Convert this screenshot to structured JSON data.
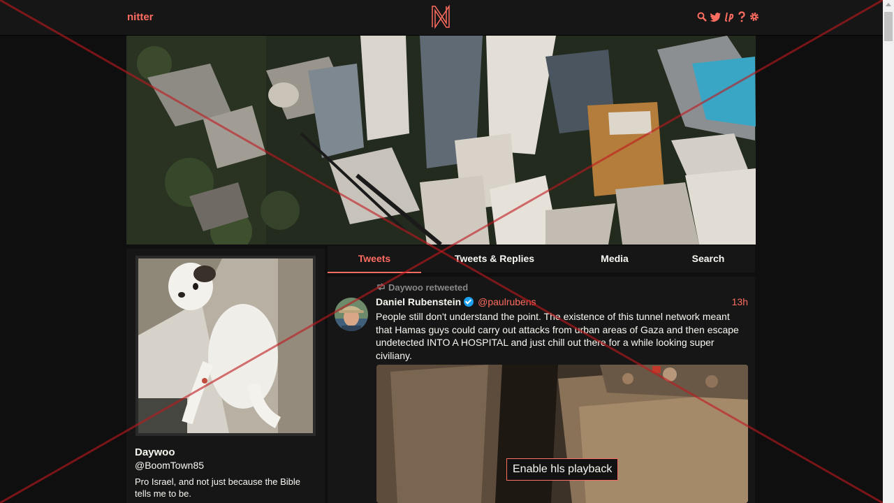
{
  "nav": {
    "brand": "nitter",
    "icons": [
      "search-icon",
      "twitter-icon",
      "liberapay-icon",
      "help-icon",
      "settings-icon"
    ]
  },
  "profile": {
    "name": "Daywoo",
    "handle": "@BoomTown85",
    "bio": "Pro Israel, and not just because the Bible tells me to be."
  },
  "tabs": [
    {
      "label": "Tweets",
      "active": true
    },
    {
      "label": "Tweets & Replies",
      "active": false
    },
    {
      "label": "Media",
      "active": false
    },
    {
      "label": "Search",
      "active": false
    }
  ],
  "tweet": {
    "retweet_label": "Daywoo retweeted",
    "author_name": "Daniel Rubenstein",
    "author_handle": "@paulrubens",
    "date": "13h",
    "text": "People still don't understand the point. The existence of this tunnel network meant that Hamas guys could carry out attacks from urban areas of Gaza and then escape undetected INTO A HOSPITAL and just chill out there for a while looking super civiliany.",
    "media_button": "Enable hls playback"
  },
  "colors": {
    "accent": "#ff6c60",
    "background": "#0f0f0f",
    "panel": "#161616",
    "text": "#f8f8f2",
    "verified": "#1da1f2",
    "overlay_cross": "#c0181e"
  }
}
